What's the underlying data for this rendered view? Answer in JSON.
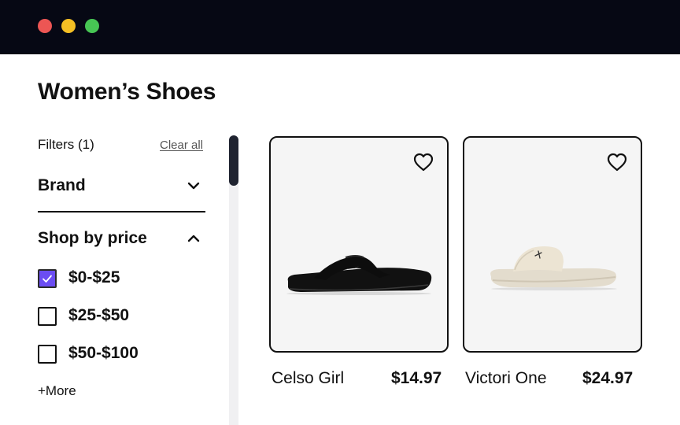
{
  "window": {
    "controls": [
      "close",
      "minimize",
      "maximize"
    ],
    "colors": {
      "titlebar": "#060814",
      "close": "#ec5654",
      "minimize": "#f4bf24",
      "maximize": "#47c554"
    }
  },
  "page": {
    "title": "Women’s Shoes"
  },
  "filters": {
    "heading": "Filters (1)",
    "clear_label": "Clear all",
    "sections": {
      "brand": {
        "title": "Brand",
        "expanded": false,
        "icon": "chevron-down-icon"
      },
      "price": {
        "title": "Shop by price",
        "expanded": true,
        "icon": "chevron-up-icon",
        "options": [
          {
            "label": "$0-$25",
            "checked": true
          },
          {
            "label": "$25-$50",
            "checked": false
          },
          {
            "label": "$50-$100",
            "checked": false
          }
        ],
        "more_label": "+More"
      }
    },
    "accent_color": "#6b4df2"
  },
  "products": [
    {
      "name": "Celso Girl",
      "price": "$14.97",
      "image": "black flip-flop sandal",
      "favorite_icon": "heart-icon"
    },
    {
      "name": "Victori One",
      "price": "$24.97",
      "image": "beige slide sandal",
      "favorite_icon": "heart-icon"
    }
  ]
}
